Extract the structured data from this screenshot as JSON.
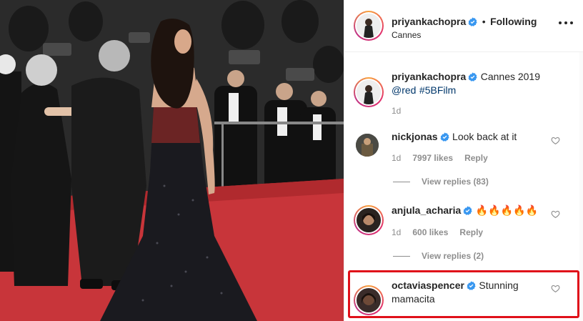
{
  "post": {
    "username": "priyankachopra",
    "separator": "•",
    "follow_label": "Following",
    "location": "Cannes"
  },
  "caption": {
    "username": "priyankachopra",
    "text": "Cannes 2019",
    "mention": "@red",
    "hashtag": "#5BFilm",
    "time": "1d"
  },
  "comments": [
    {
      "username": "nickjonas",
      "text": "Look back at it",
      "time": "1d",
      "likes": "7997 likes",
      "reply_label": "Reply",
      "view_replies": "View replies (83)"
    },
    {
      "username": "anjula_acharia",
      "text": "🔥🔥🔥🔥🔥",
      "time": "1d",
      "likes": "600 likes",
      "reply_label": "Reply",
      "view_replies": "View replies (2)"
    },
    {
      "username": "octaviaspencer",
      "text_line1": "Stunning",
      "text_line2": "mamacita"
    }
  ],
  "icons": {
    "verified": "verified-badge-icon",
    "heart": "heart-outline-icon",
    "more": "more-options-icon"
  },
  "colors": {
    "verified_blue": "#3897f0",
    "link_blue": "#00376b",
    "highlight_red": "#e0101a",
    "carpet_red": "#c8353a"
  }
}
